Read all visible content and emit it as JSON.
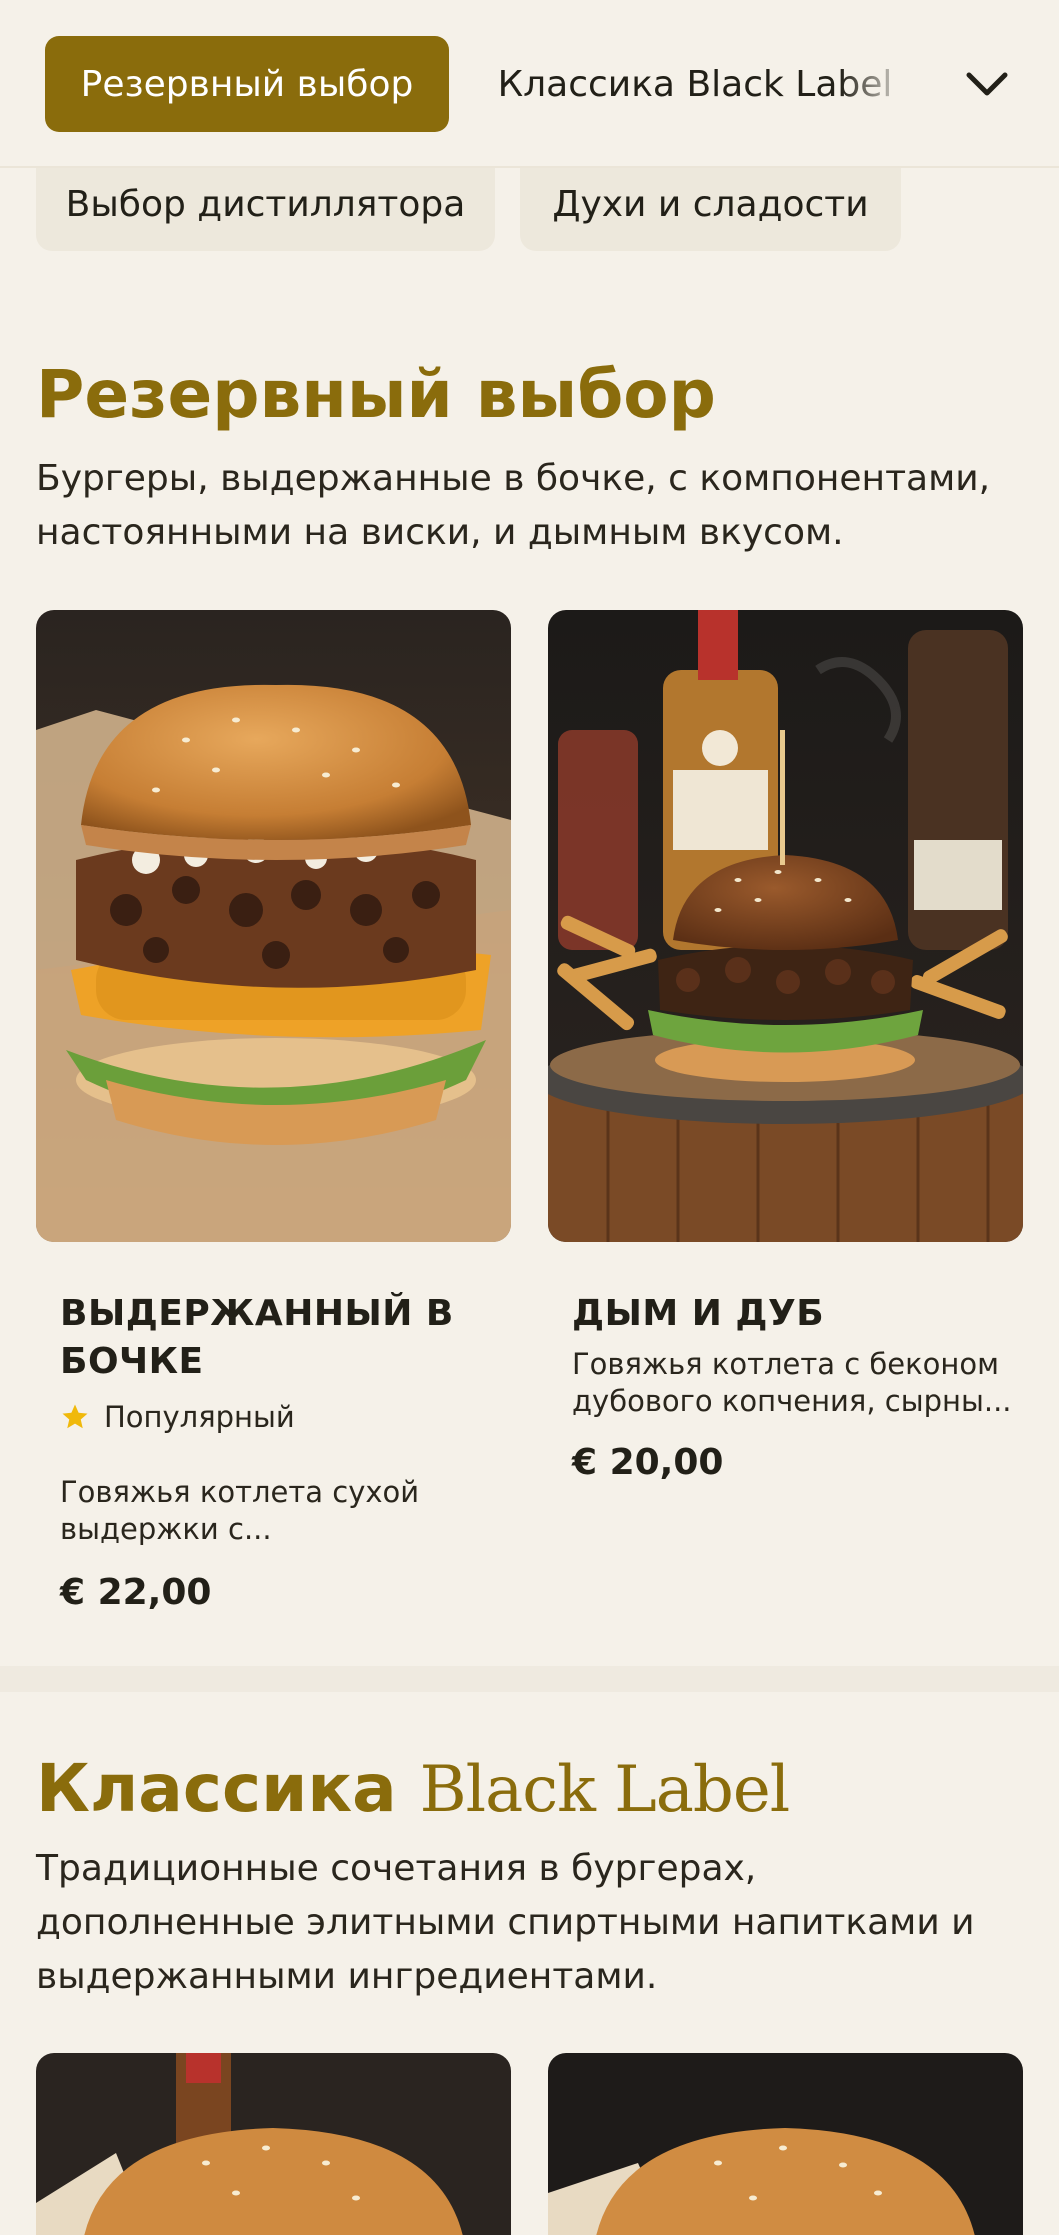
{
  "category_nav": {
    "active": "Резервный выбор",
    "next": "Классика Black Label",
    "row2": [
      "Выбор дистиллятора",
      "Духи и сладости"
    ]
  },
  "sections": [
    {
      "title": "Резервный выбор",
      "description": "Бургеры, выдержанные в бочке, с компонентами, настоянными на виски, и дымным вкусом.",
      "items": [
        {
          "name": "ВЫДЕРЖАННЫЙ В БОЧКЕ",
          "badge": "Популярный",
          "description": "Говяжья котлета сухой выдержки с...",
          "price": "€ 22,00"
        },
        {
          "name": "ДЫМ И ДУБ",
          "description": "Говяжья котлета с беконом дубового копчения, сырны...",
          "price": "€ 20,00"
        }
      ]
    },
    {
      "title_part1": "Классика",
      "title_part2": "Black Label",
      "description": "Традиционные сочетания в бургерах, дополненные элитными спиртными напитками и выдержанными ингредиентами."
    }
  ],
  "colors": {
    "accent": "#8a6c0c",
    "background": "#f5f1e9",
    "chip": "#ede8dc",
    "star": "#f0b90b"
  },
  "icons": [
    "chevron-down-icon",
    "star-icon"
  ]
}
